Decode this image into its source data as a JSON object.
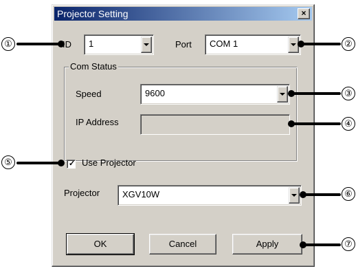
{
  "window": {
    "title": "Projector Setting",
    "close_glyph": "×"
  },
  "id_field": {
    "label": "ID",
    "value": "1"
  },
  "port_field": {
    "label": "Port",
    "value": "COM 1"
  },
  "com_status": {
    "group_label": "Com Status",
    "speed_label": "Speed",
    "speed_value": "9600",
    "ip_label": "IP Address",
    "ip_value": ""
  },
  "use_projector": {
    "label": "Use Projector",
    "checked": true,
    "check_glyph": "✓"
  },
  "projector_field": {
    "label": "Projector",
    "value": "XGV10W"
  },
  "buttons": {
    "ok": "OK",
    "cancel": "Cancel",
    "apply": "Apply"
  },
  "callouts": [
    "①",
    "②",
    "③",
    "④",
    "⑤",
    "⑥",
    "⑦"
  ]
}
